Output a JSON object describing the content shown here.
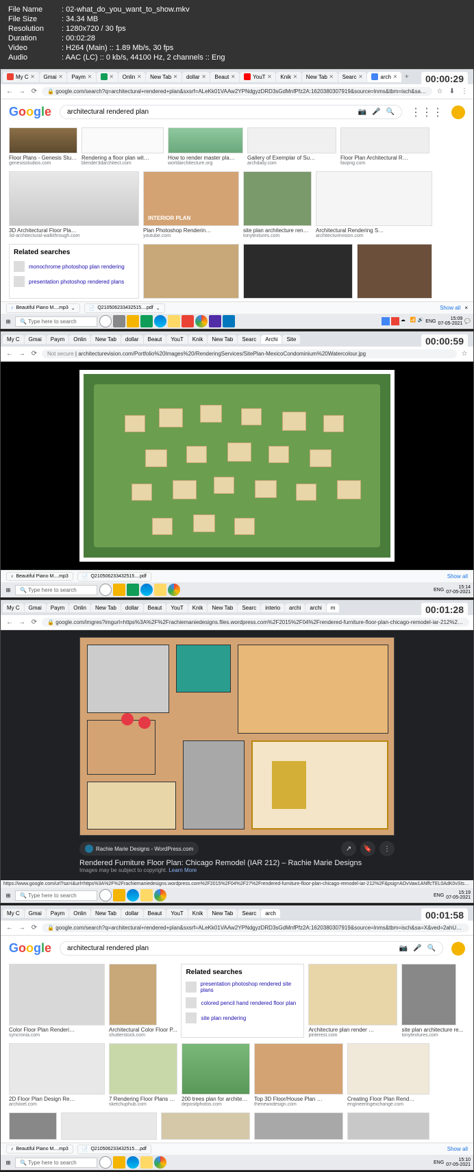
{
  "fileinfo": {
    "filename_label": "File Name",
    "filename": "02-what_do_you_want_to_show.mkv",
    "filesize_label": "File Size",
    "filesize": "34.34 MB",
    "resolution_label": "Resolution",
    "resolution": "1280x720 / 30 fps",
    "duration_label": "Duration",
    "duration": "00:02:28",
    "video_label": "Video",
    "video": "H264 (Main) :: 1.89 Mb/s, 30 fps",
    "audio_label": "Audio",
    "audio": "AAC (LC) :: 0 kb/s, 44100 Hz, 2 channels :: Eng"
  },
  "timestamps": [
    "00:00:29",
    "00:00:59",
    "00:01:28",
    "00:01:58"
  ],
  "common": {
    "search_placeholder": "Type here to search",
    "show_all": "Show all",
    "time1": "15:09",
    "time2": "15:14",
    "time3": "15:19",
    "time4": "15:10",
    "date": "07-05-2021",
    "lang": "ENG",
    "download1": "Beautiful Piano M....mp3",
    "download2": "Q210506233432515....pdf"
  },
  "tabs": [
    {
      "label": "My C"
    },
    {
      "label": "Gmai"
    },
    {
      "label": "Paym"
    },
    {
      "label": ""
    },
    {
      "label": "Onlin"
    },
    {
      "label": "New Tab"
    },
    {
      "label": "dollar"
    },
    {
      "label": "Beaut"
    },
    {
      "label": "YouT"
    },
    {
      "label": "Knik"
    },
    {
      "label": "New Tab"
    },
    {
      "label": "Searc"
    },
    {
      "label": "arch",
      "active": true
    }
  ],
  "tabs3": [
    {
      "label": "My C"
    },
    {
      "label": "Gmai"
    },
    {
      "label": "Paym"
    },
    {
      "label": ""
    },
    {
      "label": "Onlin"
    },
    {
      "label": "New Tab"
    },
    {
      "label": "dollar"
    },
    {
      "label": "Beaut"
    },
    {
      "label": "YouT"
    },
    {
      "label": "Knik"
    },
    {
      "label": "New Tab"
    },
    {
      "label": "Searc"
    },
    {
      "label": "interio"
    },
    {
      "label": "archi"
    },
    {
      "label": "archi"
    },
    {
      "label": "m",
      "active": true
    }
  ],
  "s1": {
    "url": "google.com/search?q=architectural+rendered+plan&sxsrf=ALeKk01VAAw2YPNdgyzDRD3sGdMnfPfz2A:1620380307919&source=lnms&tbm=isch&sa=X&ved=2ahUKEwi052Fo...",
    "query": "architectural rendered plan",
    "results_row1": [
      {
        "title": "Floor Plans - Genesis Studios",
        "src": "genesisstudios.com"
      },
      {
        "title": "Rendering a floor plan with Blend...",
        "src": "blender3darchitect.com"
      },
      {
        "title": "How to render master plan in photoshop ...",
        "src": "worldarchitecture.org"
      },
      {
        "title": "Gallery of Exemplar of Sustainable ...",
        "src": "archdaily.com"
      },
      {
        "title": "Floor Plan Architectural Rendering ...",
        "src": "favpng.com"
      }
    ],
    "results_row2": [
      {
        "title": "3D Architectural Floor Plans, Home ...",
        "src": "3d-architectural-walkthrough.com"
      },
      {
        "title": "Plan Photoshop Rendering Monotone ...",
        "src": "youtube.com"
      },
      {
        "title": "site plan architecture renderin ...",
        "src": "tonytextures.com"
      },
      {
        "title": "Architectural Rendering Services",
        "src": "architecturevision.com"
      }
    ],
    "related_title": "Related searches",
    "related": [
      "monochrome photoshop plan rendering",
      "presentation photoshop rendered plans"
    ],
    "interior_label": "INTERIOR PLAN"
  },
  "s2": {
    "url": "architecturevision.com/Portfolio%20Images%20/RenderingServices/SitePlan-MexicoCondominium%20Watercolour.jpg",
    "not_secure": "Not secure"
  },
  "s3": {
    "url": "google.com/imgres?imgurl=https%3A%2F%2Frachiemaniedesigns.files.wordpress.com%2F2015%2F04%2Frendered-furniture-floor-plan-chicago-remodel-iar-212%2F0.jpg&imgrefurl=https%3A%2F%2Frachiemaniedesigns.wo...",
    "source_label": "Rachie Marie Designs - WordPress.com",
    "title": "Rendered Furniture Floor Plan: Chicago Remodel (IAR 212) – Rachie Marie Designs",
    "copyright": "Images may be subject to copyright.",
    "learn_more": "Learn More",
    "url_hint": "https://www.google.com/url?sa=i&url=https%3A%2F%2Frachiemaniedesigns.wordpress.com%2F2015%2F04%2F27%2Frendered-furniture-floor-plan-chicago-remodel-iar-212%2F&psig=AOvVaw1ANffcTEL0AdK0vStsnk60&ust=162046773..."
  },
  "s4": {
    "url": "google.com/search?q=architectural+rendered+plan&sxsrf=ALeKk01VAAw2YPNdgyzDRD3sGdMnfPfz2A:1620380307919&source=lnms&tbm=isch&sa=X&ved=2ahUKEwi052Fo...",
    "query": "architectural rendered plan",
    "results_row1": [
      {
        "title": "Color Floor Plan Rendering Photoshop ...",
        "src": "syncronia.com"
      },
      {
        "title": "Architectural Color Floor P...",
        "src": "shutterstock.com"
      }
    ],
    "related_title": "Related searches",
    "related": [
      "presentation photoshop rendered site plans",
      "colored pencil hand rendered floor plan",
      "site plan rendering"
    ],
    "results_row1b": [
      {
        "title": "Architecture plan render by photoshop ...",
        "src": "pinterest.com"
      },
      {
        "title": "site plan architecture re...",
        "src": "tonytextures.com"
      }
    ],
    "results_row2": [
      {
        "title": "2D Floor Plan Design Rendering using ...",
        "src": "archiixel.com"
      },
      {
        "title": "7 Rendering Floor Plans & Elevations ...",
        "src": "sketchuphub.com"
      },
      {
        "title": "200 trees plan for architectural ... — in stock",
        "src": "depositphotos.com"
      },
      {
        "title": "Top 3D Floor/House Plan Rendering ...",
        "src": "thenewxdesign.com"
      },
      {
        "title": "Creating Floor Plan Rendering Services ...",
        "src": "engineeringexchange.com"
      }
    ]
  }
}
